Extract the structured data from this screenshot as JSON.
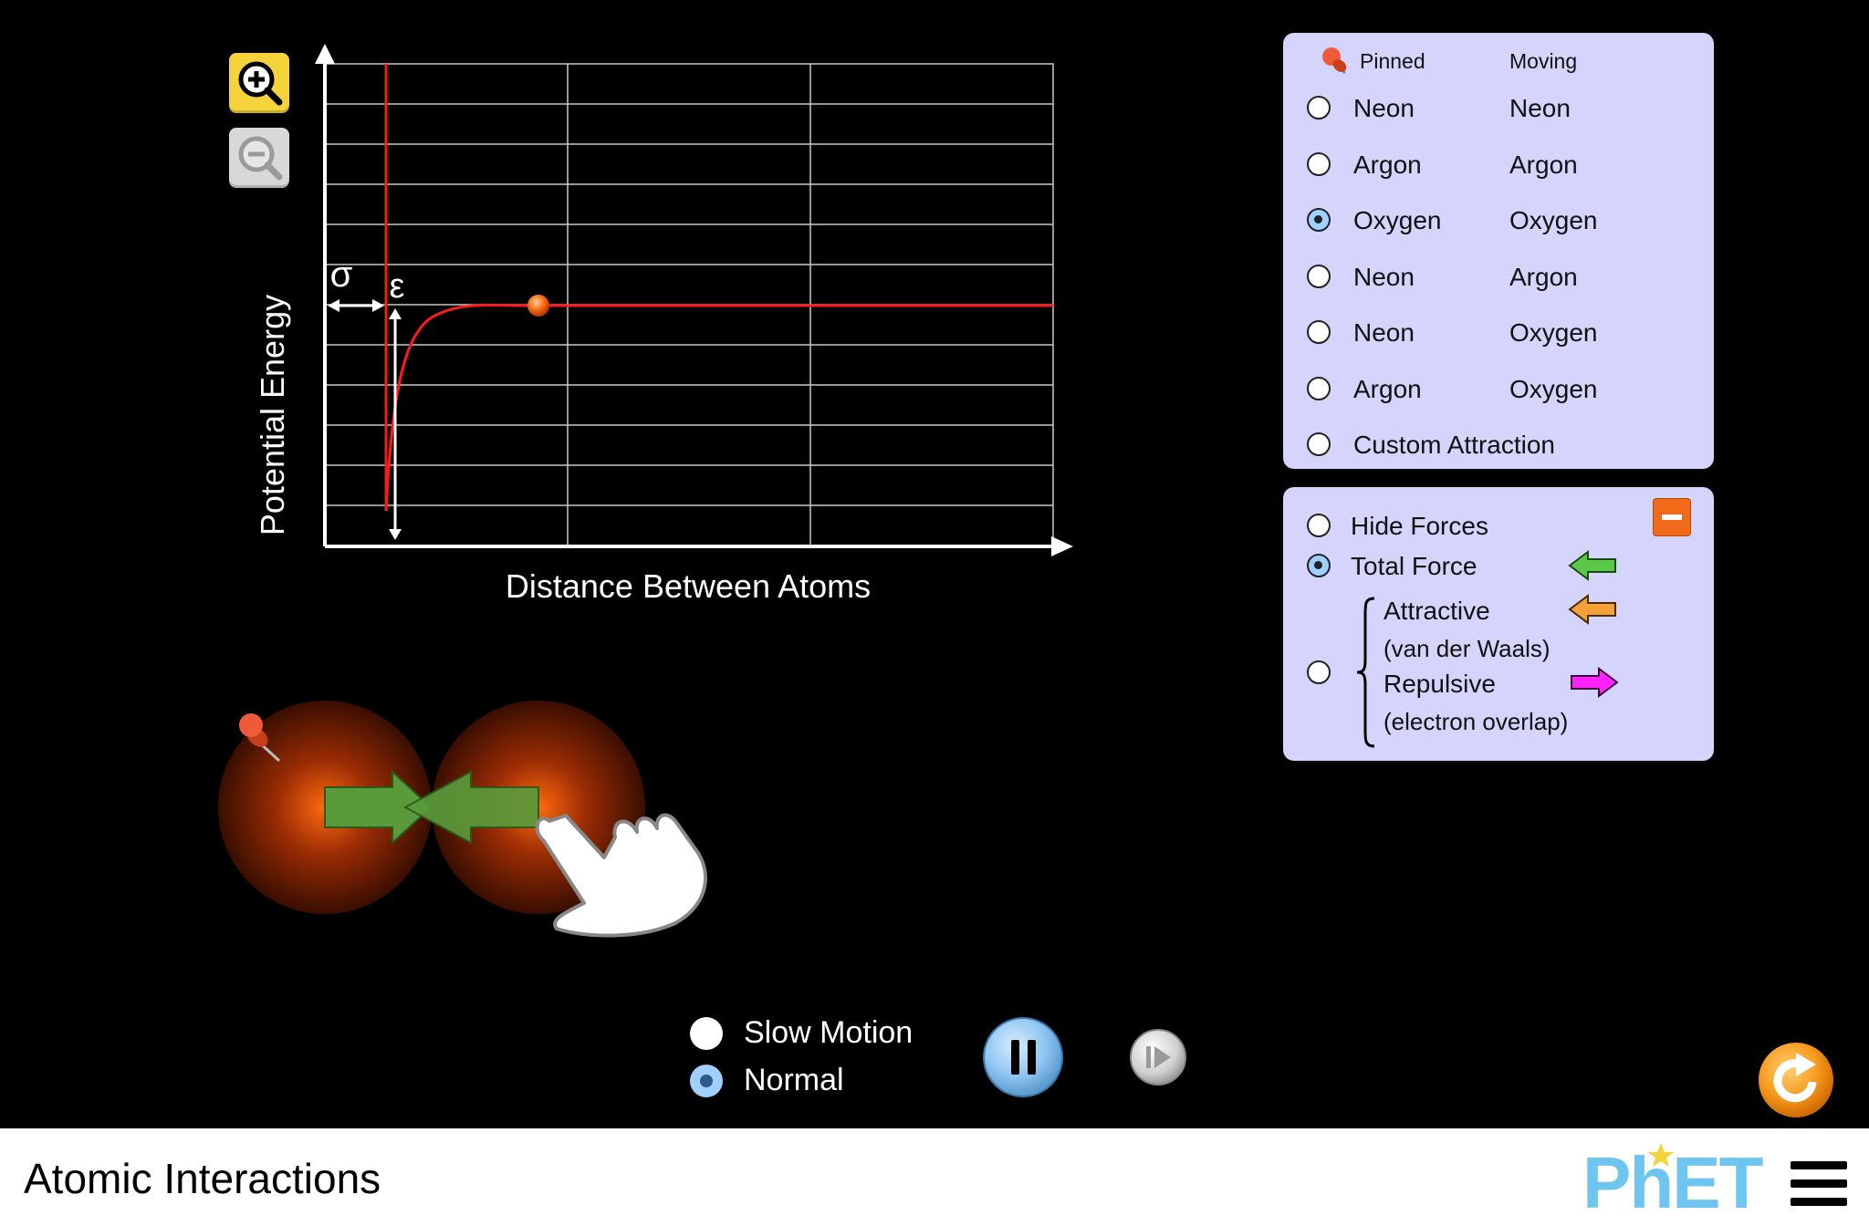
{
  "chart": {
    "y_label": "Potential Energy",
    "x_label": "Distance Between Atoms",
    "sigma_symbol": "σ",
    "epsilon_symbol": "ε"
  },
  "atom_panel": {
    "pinned_header": "Pinned",
    "moving_header": "Moving",
    "options": [
      {
        "pinned": "Neon",
        "moving": "Neon",
        "selected": false
      },
      {
        "pinned": "Argon",
        "moving": "Argon",
        "selected": false
      },
      {
        "pinned": "Oxygen",
        "moving": "Oxygen",
        "selected": true
      },
      {
        "pinned": "Neon",
        "moving": "Argon",
        "selected": false
      },
      {
        "pinned": "Neon",
        "moving": "Oxygen",
        "selected": false
      },
      {
        "pinned": "Argon",
        "moving": "Oxygen",
        "selected": false
      }
    ],
    "custom_label": "Custom Attraction"
  },
  "force_panel": {
    "hide_forces": "Hide Forces",
    "total_force": "Total Force",
    "attractive": "Attractive",
    "attractive_sub": "(van der Waals)",
    "repulsive": "Repulsive",
    "repulsive_sub": "(electron overlap)",
    "selected": "total_force",
    "colors": {
      "total": "#5cc84a",
      "attractive": "#f5a038",
      "repulsive": "#ff22ff"
    }
  },
  "controls": {
    "slow_motion": "Slow Motion",
    "normal": "Normal",
    "selected_speed": "normal"
  },
  "footer": {
    "title": "Atomic Interactions",
    "brand": "PhET"
  }
}
